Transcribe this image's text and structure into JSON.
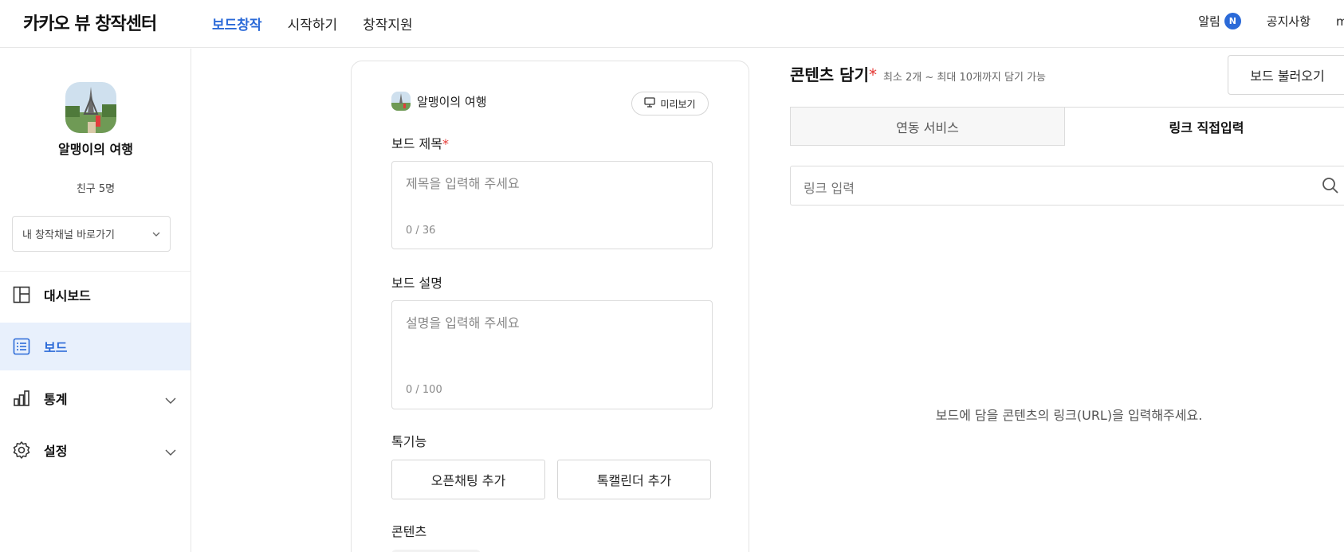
{
  "header": {
    "logo": "카카오 뷰 창작센터",
    "nav": [
      "보드창작",
      "시작하기",
      "창작지원"
    ],
    "alarm_label": "알림",
    "alarm_badge": "N",
    "notice_label": "공지사항",
    "truncated_label": "m"
  },
  "sidebar": {
    "channel_name": "알맹이의 여행",
    "friends_label": "친구 5명",
    "channel_select": "내 창작채널 바로가기",
    "menu": [
      {
        "label": "대시보드",
        "icon": "dashboard-icon"
      },
      {
        "label": "보드",
        "icon": "board-list-icon"
      },
      {
        "label": "통계",
        "icon": "stats-icon"
      },
      {
        "label": "설정",
        "icon": "settings-icon"
      }
    ]
  },
  "form": {
    "channel_name": "알맹이의 여행",
    "preview_label": "미리보기",
    "title_label": "보드 제목",
    "required_mark": "*",
    "title_placeholder": "제목을 입력해 주세요",
    "title_count": "0 / 36",
    "desc_label": "보드 설명",
    "desc_placeholder": "설명을 입력해 주세요",
    "desc_count": "0 / 100",
    "talk_label": "톡기능",
    "openchat_button": "오픈채팅 추가",
    "talkcal_button": "톡캘린더 추가",
    "content_label": "콘텐츠"
  },
  "content_panel": {
    "title": "콘텐츠 담기",
    "required_mark": "*",
    "subtitle": "최소 2개 ~ 최대 10개까지 담기 가능",
    "load_button": "보드 불러오기",
    "tabs": [
      "연동 서비스",
      "링크 직접입력"
    ],
    "active_tab": 1,
    "link_placeholder": "링크 입력",
    "empty_message": "보드에 담을 콘텐츠의 링크(URL)을 입력해주세요."
  },
  "colors": {
    "accent": "#2b6ad8",
    "required": "#e53935",
    "active_menu_bg": "#e8f0fc"
  }
}
